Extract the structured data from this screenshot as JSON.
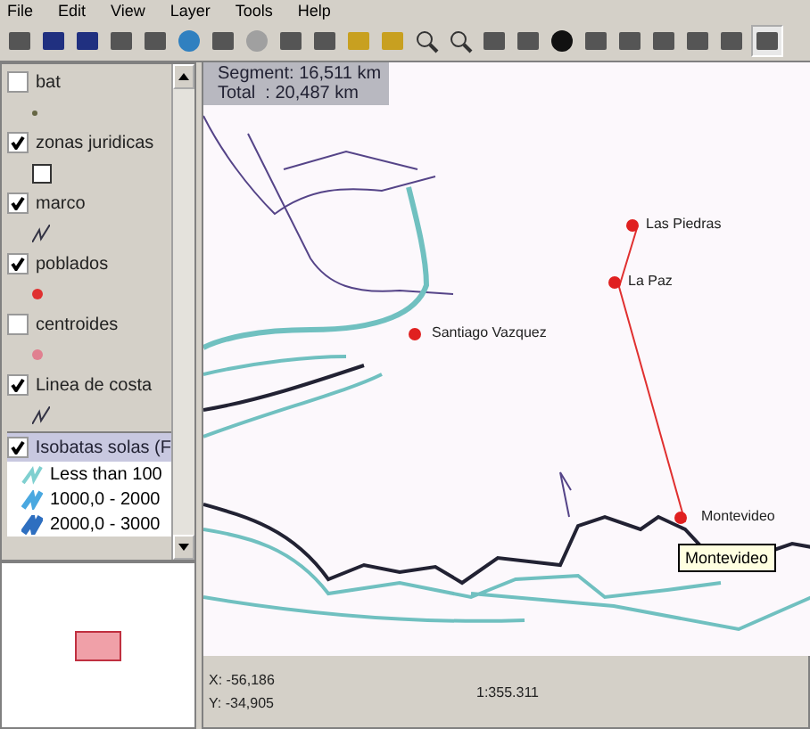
{
  "menu": [
    "File",
    "Edit",
    "View",
    "Layer",
    "Tools",
    "Help"
  ],
  "legend": {
    "layers": [
      {
        "name": "bat",
        "checked": false,
        "selected": false,
        "kind": "dot"
      },
      {
        "name": "zonas juridicas",
        "checked": true,
        "selected": false,
        "kind": "square"
      },
      {
        "name": "marco",
        "checked": true,
        "selected": false,
        "kind": "line"
      },
      {
        "name": "poblados",
        "checked": true,
        "selected": false,
        "kind": "reddot"
      },
      {
        "name": "centroides",
        "checked": false,
        "selected": false,
        "kind": "pinkdot"
      },
      {
        "name": "Linea de costa",
        "checked": true,
        "selected": false,
        "kind": "line"
      },
      {
        "name": "Isobatas solas (F",
        "checked": true,
        "selected": true,
        "kind": "classes",
        "children": [
          {
            "label": "Less than 100",
            "color": "#7fd0d0"
          },
          {
            "label": "1000,0 - 2000",
            "color": "#4aa8e0"
          },
          {
            "label": "2000,0 - 3000",
            "color": "#2e6fc0"
          }
        ]
      }
    ]
  },
  "measure": {
    "segment": "Segment: 16,511 km",
    "total": "Total  : 20,487 km"
  },
  "cities": [
    {
      "name": "Las Piedras"
    },
    {
      "name": "La Paz"
    },
    {
      "name": "Santiago Vazquez"
    },
    {
      "name": "Montevideo"
    }
  ],
  "tooltip": "Montevideo",
  "status": {
    "x": "X: -56,186",
    "y": "Y: -34,905",
    "scale": "1:355.311"
  }
}
